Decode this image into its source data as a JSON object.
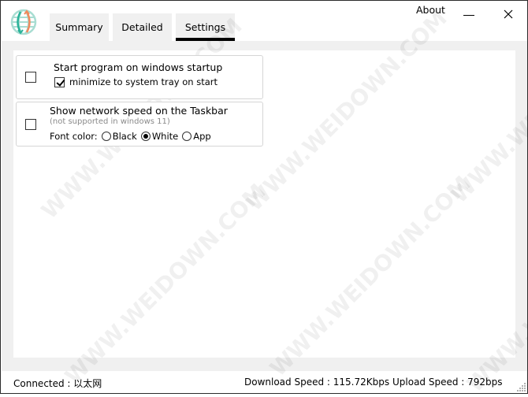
{
  "window": {
    "about_label": "About",
    "minimize_icon": "minimize-icon",
    "close_icon": "close-icon",
    "logo_icon": "globe-arrows-icon"
  },
  "tabs": [
    {
      "label": "Summary",
      "active": false
    },
    {
      "label": "Detailed",
      "active": false
    },
    {
      "label": "Settings",
      "active": true
    }
  ],
  "settings": {
    "startup": {
      "label": "Start program on windows startup",
      "checked": false,
      "minimize_tray": {
        "label": "minimize to system tray on start",
        "checked": true
      }
    },
    "taskbar": {
      "label": "Show network speed on the Taskbar",
      "checked": false,
      "note": "(not supported in windows 11)",
      "font_color_label": "Font color:",
      "options": [
        {
          "label": "Black",
          "selected": false
        },
        {
          "label": "White",
          "selected": true
        },
        {
          "label": "App",
          "selected": false
        }
      ]
    }
  },
  "status_bar": {
    "connected": "Connected : 以太网",
    "download": "Download Speed : 115.72Kbps",
    "upload": "Upload Speed : 792bps"
  },
  "colors": {
    "logo_teal": "#2bb39a",
    "logo_orange": "#f08a5d",
    "tab_bg": "#f0f0f0",
    "active_tab_underline": "#000000"
  },
  "watermark": "WWW.WEIDOWN.COM"
}
